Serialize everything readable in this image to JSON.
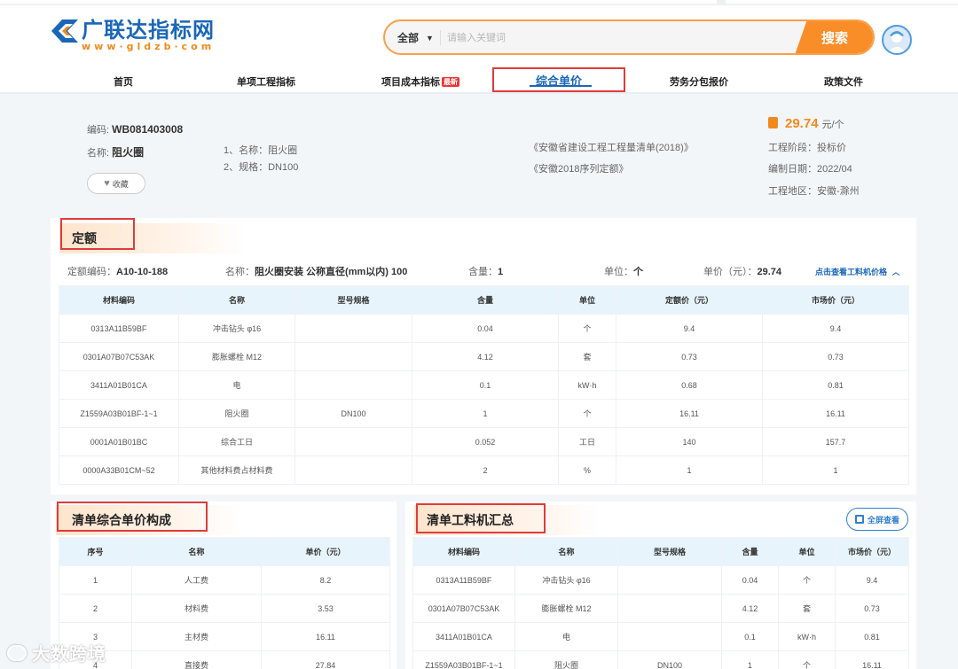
{
  "site": {
    "name": "广联达指标网",
    "url": "www·gldzb·com"
  },
  "search": {
    "scope": "全部",
    "placeholder": "请输入关键词",
    "button": "搜索"
  },
  "nav": {
    "items": [
      "首页",
      "单项工程指标",
      "项目成本指标",
      "综合单价",
      "劳务分包报价",
      "政策文件"
    ],
    "new_badge": "最新",
    "active": "综合单价"
  },
  "item": {
    "code_label": "编码:",
    "code": "WB081403008",
    "name_label": "名称:",
    "name": "阻火圈",
    "features": [
      "1、名称：阻火圈",
      "2、规格：DN100"
    ],
    "refs": [
      "《安徽省建设工程工程量清单(2018)》",
      "《安徽2018序列定额》"
    ],
    "favorite": "收藏",
    "price": "29.74",
    "price_unit": "元/个",
    "stage": "工程阶段：投标价",
    "date": "编制日期：2022/04",
    "region": "工程地区：安徽-滁州"
  },
  "quota": {
    "title": "定额",
    "code_label": "定额编码：",
    "code": "A10-10-188",
    "name_label": "名称：",
    "name": "阻火圈安装 公称直径(mm以内) 100",
    "qty_label": "含量：",
    "qty": "1",
    "unit_label": "单位：",
    "unit": "个",
    "price_label": "单价（元）：",
    "price": "29.74",
    "link": "点击查看工料机价格",
    "columns": [
      "材料编码",
      "名称",
      "型号规格",
      "含量",
      "单位",
      "定额价（元）",
      "市场价（元）"
    ],
    "rows": [
      [
        "0313A11B59BF",
        "冲击钻头 φ16",
        "",
        "0.04",
        "个",
        "9.4",
        "9.4"
      ],
      [
        "0301A07B07C53AK",
        "膨胀螺栓 M12",
        "",
        "4.12",
        "套",
        "0.73",
        "0.73"
      ],
      [
        "3411A01B01CA",
        "电",
        "",
        "0.1",
        "kW·h",
        "0.68",
        "0.81"
      ],
      [
        "Z1559A03B01BF-1~1",
        "阻火圈",
        "DN100",
        "1",
        "个",
        "16.11",
        "16.11"
      ],
      [
        "0001A01B01BC",
        "综合工日",
        "",
        "0.052",
        "工日",
        "140",
        "157.7"
      ],
      [
        "0000A33B01CM~52",
        "其他材料费占材料费",
        "",
        "2",
        "%",
        "1",
        "1"
      ]
    ]
  },
  "composition": {
    "title": "清单综合单价构成",
    "columns": [
      "序号",
      "名称",
      "单价（元）"
    ],
    "rows": [
      [
        "1",
        "人工费",
        "8.2"
      ],
      [
        "2",
        "材料费",
        "3.53"
      ],
      [
        "3",
        "主材费",
        "16.11"
      ],
      [
        "4",
        "直接费",
        "27.84"
      ]
    ]
  },
  "summary": {
    "title": "清单工料机汇总",
    "fullscreen": "全屏查看",
    "columns": [
      "材料编码",
      "名称",
      "型号规格",
      "含量",
      "单位",
      "市场价（元）"
    ],
    "rows": [
      [
        "0313A11B59BF",
        "冲击钻头 φ16",
        "",
        "0.04",
        "个",
        "9.4"
      ],
      [
        "0301A07B07C53AK",
        "膨胀螺栓 M12",
        "",
        "4.12",
        "套",
        "0.73"
      ],
      [
        "3411A01B01CA",
        "电",
        "",
        "0.1",
        "kW·h",
        "0.81"
      ],
      [
        "Z1559A03B01BF-1~1",
        "阻火圈",
        "DN100",
        "1",
        "个",
        "16.11"
      ]
    ]
  },
  "watermark": "大数跨境",
  "colors": {
    "brand_blue": "#1a66b8",
    "brand_orange": "#f98d28",
    "highlight_red": "#e03b3b",
    "table_header": "#e8f4fb"
  }
}
